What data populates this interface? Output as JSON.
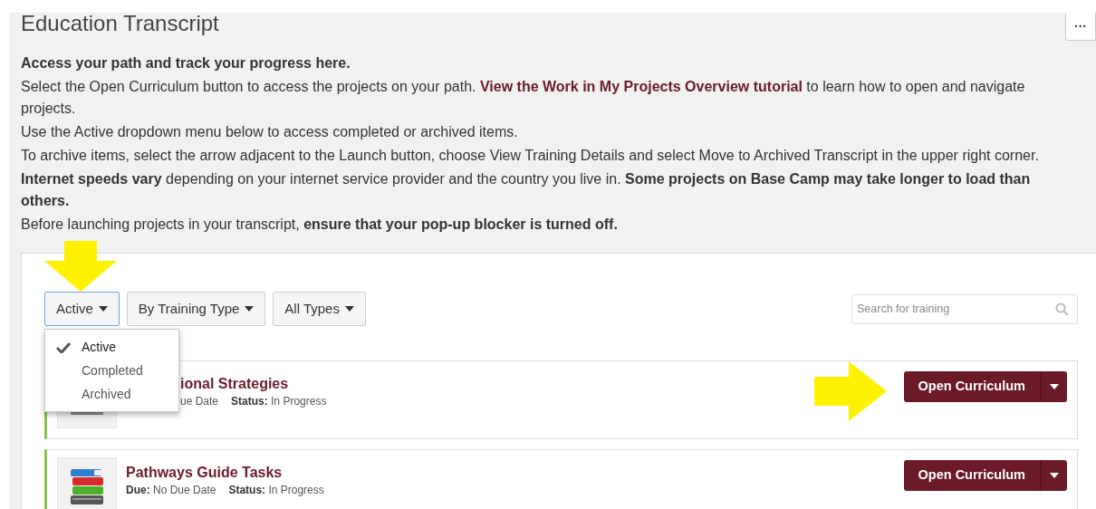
{
  "page": {
    "title": "Education Transcript",
    "more_button": "···"
  },
  "intro": [
    {
      "text": "Access your path and track your progress here.",
      "bold": true
    },
    {
      "bold": false,
      "text": "Select the Open Curriculum button to access the projects on your path.",
      "link": "View the Work in My Projects Overview tutorial",
      "after": "to learn how to open and navigate projects."
    },
    {
      "bold": false,
      "text": "Use the Active dropdown menu below to access completed or archived items."
    },
    {
      "bold": false,
      "text": "To archive items, select the arrow adjacent to the Launch button, choose View Training Details and select Move to Archived Transcript in the upper right corner."
    },
    {
      "bold": false,
      "text": "**Internet speeds vary** depending on your internet service provider and the country you live in. **Some projects on Base Camp may take longer to load than others.**"
    },
    {
      "bold": false,
      "text": "Before launching projects in your transcript, **ensure that your pop-up blocker is turned off.**"
    }
  ],
  "filters": [
    {
      "label": "Active",
      "open": true,
      "annotated": true
    },
    {
      "label": "By Training Type",
      "open": false,
      "annotated": false
    },
    {
      "label": "All Types",
      "open": false,
      "annotated": false
    }
  ],
  "status_menu": {
    "items": [
      {
        "label": "Active",
        "selected": true
      },
      {
        "label": "Completed",
        "selected": false
      },
      {
        "label": "Archived",
        "selected": false
      }
    ]
  },
  "search": {
    "placeholder": "Search for training"
  },
  "cards": [
    {
      "title": "ional Strategies",
      "due_value": "ue Date",
      "status_label": "Status:",
      "status_value": "In Progress",
      "button": "Open Curriculum",
      "kind": "generic",
      "annotated": true
    },
    {
      "title": "Pathways Guide Tasks",
      "due_label": "Due:",
      "due_value": "No Due Date",
      "status_label": "Status:",
      "status_value": "In Progress",
      "button": "Open Curriculum",
      "kind": "books",
      "annotated": false
    }
  ]
}
